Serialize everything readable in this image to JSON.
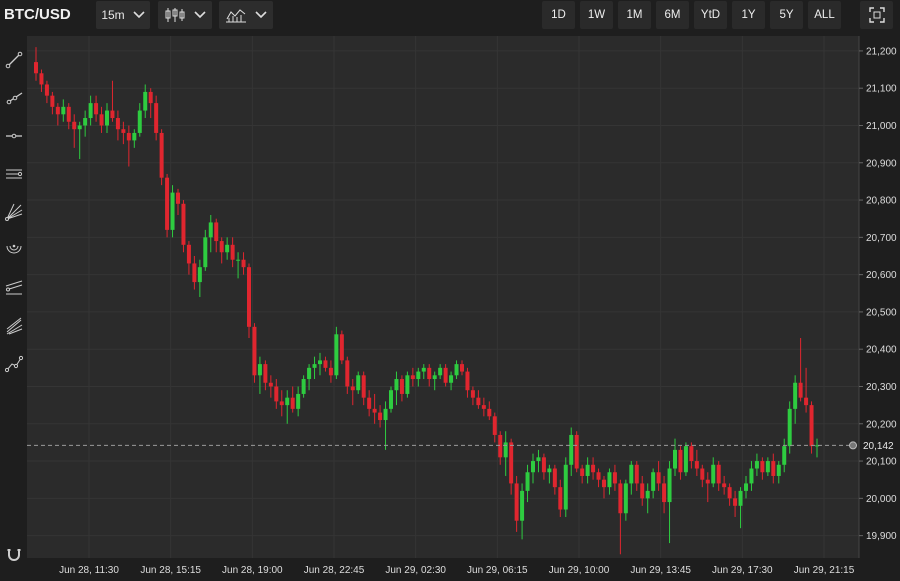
{
  "header": {
    "symbol": "BTC/USD",
    "interval": "15m",
    "chart_type_icon": "candlestick-icon",
    "indicator_icon": "indicators-icon",
    "ranges": [
      "1D",
      "1W",
      "1M",
      "6M",
      "YtD",
      "1Y",
      "5Y",
      "ALL"
    ],
    "fullscreen_icon": "fullscreen-icon"
  },
  "sidebar": {
    "tools": [
      "trend-line-icon",
      "ray-icon",
      "horizontal-line-icon",
      "parallel-channel-icon",
      "fib-fan-icon",
      "fib-arc-icon",
      "pitchfork-icon",
      "gann-fan-icon",
      "path-icon"
    ],
    "bottom_tool": "magnet-icon"
  },
  "colors": {
    "up": "#2ecc40",
    "down": "#e0262f",
    "background": "#2b2b2b",
    "grid": "#353535",
    "axis_text": "#dddddd"
  },
  "chart_data": {
    "type": "candlestick",
    "title": "",
    "xlabel": "",
    "ylabel": "",
    "ylim": [
      19840,
      21240
    ],
    "y_ticks": [
      21200,
      21100,
      21000,
      20900,
      20800,
      20700,
      20600,
      20500,
      20400,
      20300,
      20200,
      20100,
      20000,
      19900
    ],
    "y_tick_labels": [
      "21,200",
      "21,100",
      "21,000",
      "20,900",
      "20,800",
      "20,700",
      "20,600",
      "20,500",
      "20,400",
      "20,300",
      "20,200",
      "20,100",
      "20,000",
      "19,900"
    ],
    "x_tick_labels": [
      "Jun 28, 11:30",
      "Jun 28, 15:15",
      "Jun 28, 19:00",
      "Jun 28, 22:45",
      "Jun 29, 02:30",
      "Jun 29, 06:15",
      "Jun 29, 10:00",
      "Jun 29, 13:45",
      "Jun 29, 17:30",
      "Jun 29, 21:15"
    ],
    "current_price": 20142,
    "current_price_label": "20,142",
    "grid": true,
    "candles": [
      [
        21170,
        21210,
        21120,
        21140
      ],
      [
        21140,
        21150,
        21090,
        21110
      ],
      [
        21110,
        21120,
        21060,
        21080
      ],
      [
        21080,
        21090,
        21030,
        21050
      ],
      [
        21050,
        21060,
        21000,
        21030
      ],
      [
        21030,
        21070,
        21010,
        21050
      ],
      [
        21050,
        21060,
        20990,
        21010
      ],
      [
        21010,
        21030,
        20940,
        20990
      ],
      [
        20990,
        21010,
        20910,
        21000
      ],
      [
        21000,
        21040,
        20970,
        21020
      ],
      [
        21020,
        21080,
        21000,
        21060
      ],
      [
        21060,
        21080,
        21010,
        21030
      ],
      [
        21030,
        21050,
        20980,
        21000
      ],
      [
        21000,
        21060,
        20980,
        21040
      ],
      [
        21040,
        21120,
        21010,
        21020
      ],
      [
        21020,
        21040,
        20960,
        20990
      ],
      [
        20990,
        21010,
        20950,
        20980
      ],
      [
        20980,
        21000,
        20890,
        20960
      ],
      [
        20960,
        20990,
        20940,
        20980
      ],
      [
        20980,
        21060,
        20970,
        21040
      ],
      [
        21040,
        21110,
        21020,
        21090
      ],
      [
        21090,
        21100,
        21020,
        21060
      ],
      [
        21060,
        21080,
        20960,
        20980
      ],
      [
        20980,
        20990,
        20840,
        20860
      ],
      [
        20860,
        20870,
        20700,
        20720
      ],
      [
        20720,
        20840,
        20700,
        20820
      ],
      [
        20820,
        20830,
        20760,
        20790
      ],
      [
        20790,
        20800,
        20660,
        20680
      ],
      [
        20680,
        20690,
        20600,
        20630
      ],
      [
        20630,
        20650,
        20560,
        20580
      ],
      [
        20580,
        20640,
        20540,
        20620
      ],
      [
        20620,
        20720,
        20610,
        20700
      ],
      [
        20700,
        20760,
        20660,
        20740
      ],
      [
        20740,
        20750,
        20660,
        20690
      ],
      [
        20690,
        20700,
        20630,
        20660
      ],
      [
        20660,
        20700,
        20640,
        20680
      ],
      [
        20680,
        20700,
        20620,
        20640
      ],
      [
        20640,
        20660,
        20590,
        20640
      ],
      [
        20640,
        20660,
        20600,
        20620
      ],
      [
        20620,
        20630,
        20430,
        20460
      ],
      [
        20460,
        20470,
        20310,
        20330
      ],
      [
        20330,
        20380,
        20280,
        20360
      ],
      [
        20360,
        20370,
        20290,
        20310
      ],
      [
        20310,
        20330,
        20270,
        20300
      ],
      [
        20300,
        20320,
        20240,
        20260
      ],
      [
        20260,
        20290,
        20220,
        20250
      ],
      [
        20250,
        20290,
        20200,
        20270
      ],
      [
        20270,
        20300,
        20230,
        20240
      ],
      [
        20240,
        20300,
        20220,
        20280
      ],
      [
        20280,
        20330,
        20270,
        20320
      ],
      [
        20320,
        20360,
        20290,
        20350
      ],
      [
        20350,
        20380,
        20320,
        20360
      ],
      [
        20360,
        20390,
        20330,
        20370
      ],
      [
        20370,
        20380,
        20340,
        20350
      ],
      [
        20350,
        20370,
        20310,
        20330
      ],
      [
        20330,
        20460,
        20320,
        20440
      ],
      [
        20440,
        20450,
        20360,
        20370
      ],
      [
        20370,
        20380,
        20280,
        20300
      ],
      [
        20300,
        20320,
        20250,
        20290
      ],
      [
        20290,
        20340,
        20280,
        20330
      ],
      [
        20330,
        20340,
        20250,
        20270
      ],
      [
        20270,
        20290,
        20220,
        20240
      ],
      [
        20240,
        20280,
        20200,
        20230
      ],
      [
        20230,
        20250,
        20190,
        20210
      ],
      [
        20210,
        20260,
        20130,
        20240
      ],
      [
        20240,
        20300,
        20230,
        20290
      ],
      [
        20290,
        20340,
        20250,
        20320
      ],
      [
        20320,
        20330,
        20260,
        20280
      ],
      [
        20280,
        20340,
        20270,
        20330
      ],
      [
        20330,
        20350,
        20300,
        20320
      ],
      [
        20320,
        20350,
        20300,
        20340
      ],
      [
        20340,
        20360,
        20320,
        20350
      ],
      [
        20350,
        20360,
        20300,
        20320
      ],
      [
        20320,
        20340,
        20290,
        20330
      ],
      [
        20330,
        20360,
        20320,
        20350
      ],
      [
        20350,
        20360,
        20300,
        20310
      ],
      [
        20310,
        20340,
        20290,
        20330
      ],
      [
        20330,
        20370,
        20320,
        20360
      ],
      [
        20360,
        20370,
        20330,
        20340
      ],
      [
        20340,
        20350,
        20270,
        20290
      ],
      [
        20290,
        20300,
        20250,
        20270
      ],
      [
        20270,
        20290,
        20240,
        20250
      ],
      [
        20250,
        20270,
        20220,
        20240
      ],
      [
        20240,
        20260,
        20210,
        20220
      ],
      [
        20220,
        20230,
        20150,
        20170
      ],
      [
        20170,
        20180,
        20090,
        20110
      ],
      [
        20110,
        20180,
        20060,
        20150
      ],
      [
        20150,
        20160,
        20010,
        20040
      ],
      [
        20040,
        20060,
        19910,
        19940
      ],
      [
        19940,
        20040,
        19890,
        20020
      ],
      [
        20020,
        20090,
        19990,
        20070
      ],
      [
        20070,
        20120,
        20040,
        20100
      ],
      [
        20100,
        20130,
        20070,
        20110
      ],
      [
        20110,
        20120,
        20050,
        20070
      ],
      [
        20070,
        20090,
        20040,
        20080
      ],
      [
        20080,
        20090,
        20010,
        20030
      ],
      [
        20030,
        20050,
        19950,
        19970
      ],
      [
        19970,
        20110,
        19950,
        20090
      ],
      [
        20090,
        20190,
        20060,
        20170
      ],
      [
        20170,
        20180,
        20070,
        20080
      ],
      [
        20080,
        20090,
        20040,
        20060
      ],
      [
        20060,
        20110,
        20040,
        20090
      ],
      [
        20090,
        20110,
        20050,
        20070
      ],
      [
        20070,
        20080,
        20030,
        20050
      ],
      [
        20050,
        20060,
        20000,
        20030
      ],
      [
        20030,
        20080,
        20010,
        20070
      ],
      [
        20070,
        20090,
        20020,
        20040
      ],
      [
        20040,
        20050,
        19850,
        19960
      ],
      [
        19960,
        20050,
        19940,
        20040
      ],
      [
        20040,
        20100,
        20010,
        20090
      ],
      [
        20090,
        20100,
        20020,
        20040
      ],
      [
        20040,
        20060,
        19980,
        20000
      ],
      [
        20000,
        20040,
        19960,
        20020
      ],
      [
        20020,
        20080,
        20000,
        20070
      ],
      [
        20070,
        20100,
        20020,
        20040
      ],
      [
        20040,
        20060,
        19960,
        19990
      ],
      [
        19990,
        20100,
        19880,
        20080
      ],
      [
        20080,
        20160,
        20060,
        20130
      ],
      [
        20130,
        20140,
        20050,
        20070
      ],
      [
        20070,
        20150,
        20060,
        20140
      ],
      [
        20140,
        20150,
        20080,
        20100
      ],
      [
        20100,
        20130,
        20060,
        20080
      ],
      [
        20080,
        20090,
        20030,
        20050
      ],
      [
        20050,
        20070,
        19990,
        20040
      ],
      [
        20040,
        20110,
        20030,
        20090
      ],
      [
        20090,
        20100,
        20020,
        20040
      ],
      [
        20040,
        20060,
        20010,
        20030
      ],
      [
        20030,
        20040,
        19980,
        20000
      ],
      [
        20000,
        20020,
        19950,
        19980
      ],
      [
        19980,
        20030,
        19920,
        20020
      ],
      [
        20020,
        20060,
        20000,
        20040
      ],
      [
        20040,
        20100,
        20020,
        20080
      ],
      [
        20080,
        20120,
        20060,
        20100
      ],
      [
        20100,
        20110,
        20050,
        20070
      ],
      [
        20070,
        20110,
        20060,
        20100
      ],
      [
        20100,
        20120,
        20040,
        20060
      ],
      [
        20060,
        20100,
        20040,
        20090
      ],
      [
        20090,
        20160,
        20070,
        20140
      ],
      [
        20140,
        20260,
        20120,
        20240
      ],
      [
        20240,
        20330,
        20200,
        20310
      ],
      [
        20310,
        20430,
        20260,
        20270
      ],
      [
        20270,
        20350,
        20230,
        20250
      ],
      [
        20250,
        20260,
        20120,
        20140
      ],
      [
        20140,
        20160,
        20110,
        20142
      ]
    ]
  }
}
